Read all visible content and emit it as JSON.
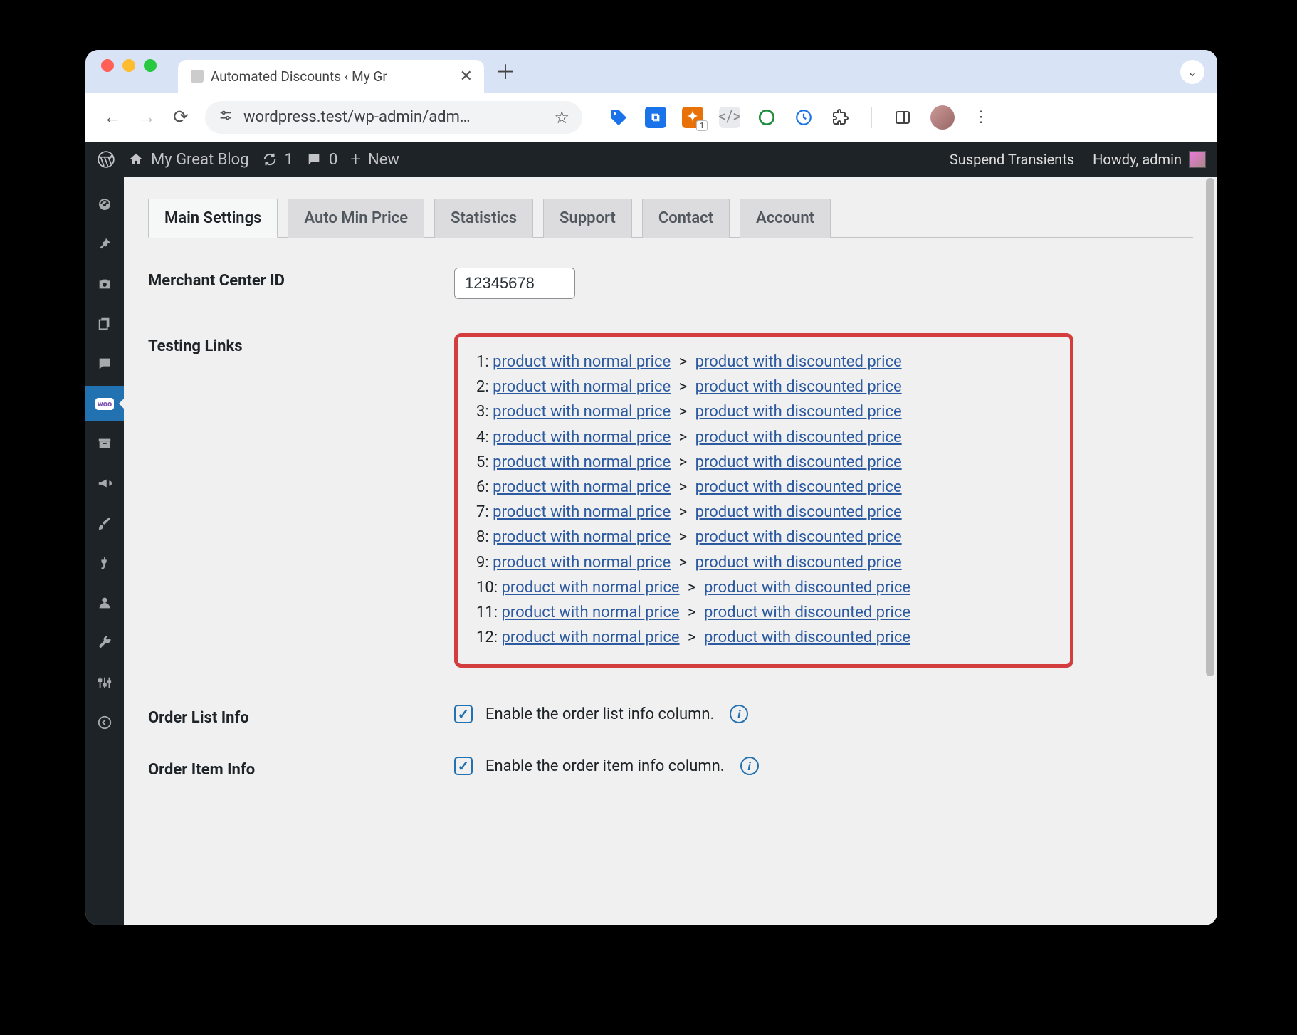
{
  "browser": {
    "tab_title": "Automated Discounts ‹ My Gr",
    "url": "wordpress.test/wp-admin/adm…",
    "ext_badge": "1"
  },
  "adminbar": {
    "site_name": "My Great Blog",
    "updates": "1",
    "comments": "0",
    "new": "New",
    "suspend": "Suspend Transients",
    "howdy": "Howdy, admin"
  },
  "sidebar_items": [
    {
      "name": "dashboard",
      "icon": "gauge"
    },
    {
      "name": "posts",
      "icon": "pin"
    },
    {
      "name": "media",
      "icon": "camera"
    },
    {
      "name": "pages",
      "icon": "stack"
    },
    {
      "name": "comments",
      "icon": "bubble"
    },
    {
      "name": "woocommerce",
      "icon": "woo",
      "active": true
    },
    {
      "name": "products",
      "icon": "archive"
    },
    {
      "name": "marketing",
      "icon": "megaphone"
    },
    {
      "name": "appearance",
      "icon": "brush"
    },
    {
      "name": "plugins",
      "icon": "plug"
    },
    {
      "name": "users",
      "icon": "user"
    },
    {
      "name": "tools",
      "icon": "wrench"
    },
    {
      "name": "settings",
      "icon": "sliders"
    },
    {
      "name": "collapse",
      "icon": "collapse"
    }
  ],
  "tabs": [
    "Main Settings",
    "Auto Min Price",
    "Statistics",
    "Support",
    "Contact",
    "Account"
  ],
  "active_tab": 0,
  "fields": {
    "merchant_id_label": "Merchant Center ID",
    "merchant_id_value": "12345678",
    "testing_links_label": "Testing Links",
    "order_list_label": "Order List Info",
    "order_list_cb": "Enable the order list info column.",
    "order_item_label": "Order Item Info",
    "order_item_cb": "Enable the order item info column."
  },
  "testing_links": [
    {
      "n": "1",
      "a": "product with normal price",
      "b": "product with discounted price"
    },
    {
      "n": "2",
      "a": "product with normal price",
      "b": "product with discounted price"
    },
    {
      "n": "3",
      "a": "product with normal price",
      "b": "product with discounted price"
    },
    {
      "n": "4",
      "a": "product with normal price",
      "b": "product with discounted price"
    },
    {
      "n": "5",
      "a": "product with normal price",
      "b": "product with discounted price"
    },
    {
      "n": "6",
      "a": "product with normal price",
      "b": "product with discounted price"
    },
    {
      "n": "7",
      "a": "product with normal price",
      "b": "product with discounted price"
    },
    {
      "n": "8",
      "a": "product with normal price",
      "b": "product with discounted price"
    },
    {
      "n": "9",
      "a": "product with normal price",
      "b": "product with discounted price"
    },
    {
      "n": "10",
      "a": "product with normal price",
      "b": "product with discounted price"
    },
    {
      "n": "11",
      "a": "product with normal price",
      "b": "product with discounted price"
    },
    {
      "n": "12",
      "a": "product with normal price",
      "b": "product with discounted price"
    }
  ]
}
